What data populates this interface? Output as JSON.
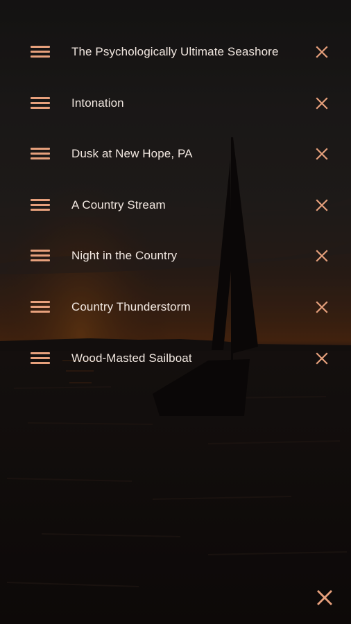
{
  "theme": {
    "accent": "#e6a07c",
    "text": "#f1e7e0",
    "overlay": "#000000"
  },
  "background": {
    "description_icon": "sailboat-sunset-image"
  },
  "playlist": {
    "tracks": [
      {
        "title": "The Psychologically Ultimate Seashore",
        "handle_icon": "drag-handle-icon",
        "remove_icon": "close-icon"
      },
      {
        "title": "Intonation",
        "handle_icon": "drag-handle-icon",
        "remove_icon": "close-icon"
      },
      {
        "title": "Dusk at New Hope, PA",
        "handle_icon": "drag-handle-icon",
        "remove_icon": "close-icon"
      },
      {
        "title": "A Country Stream",
        "handle_icon": "drag-handle-icon",
        "remove_icon": "close-icon"
      },
      {
        "title": "Night in the Country",
        "handle_icon": "drag-handle-icon",
        "remove_icon": "close-icon"
      },
      {
        "title": "Country Thunderstorm",
        "handle_icon": "drag-handle-icon",
        "remove_icon": "close-icon"
      },
      {
        "title": "Wood-Masted Sailboat",
        "handle_icon": "drag-handle-icon",
        "remove_icon": "close-icon"
      }
    ]
  },
  "footer": {
    "close_icon": "close-icon"
  }
}
